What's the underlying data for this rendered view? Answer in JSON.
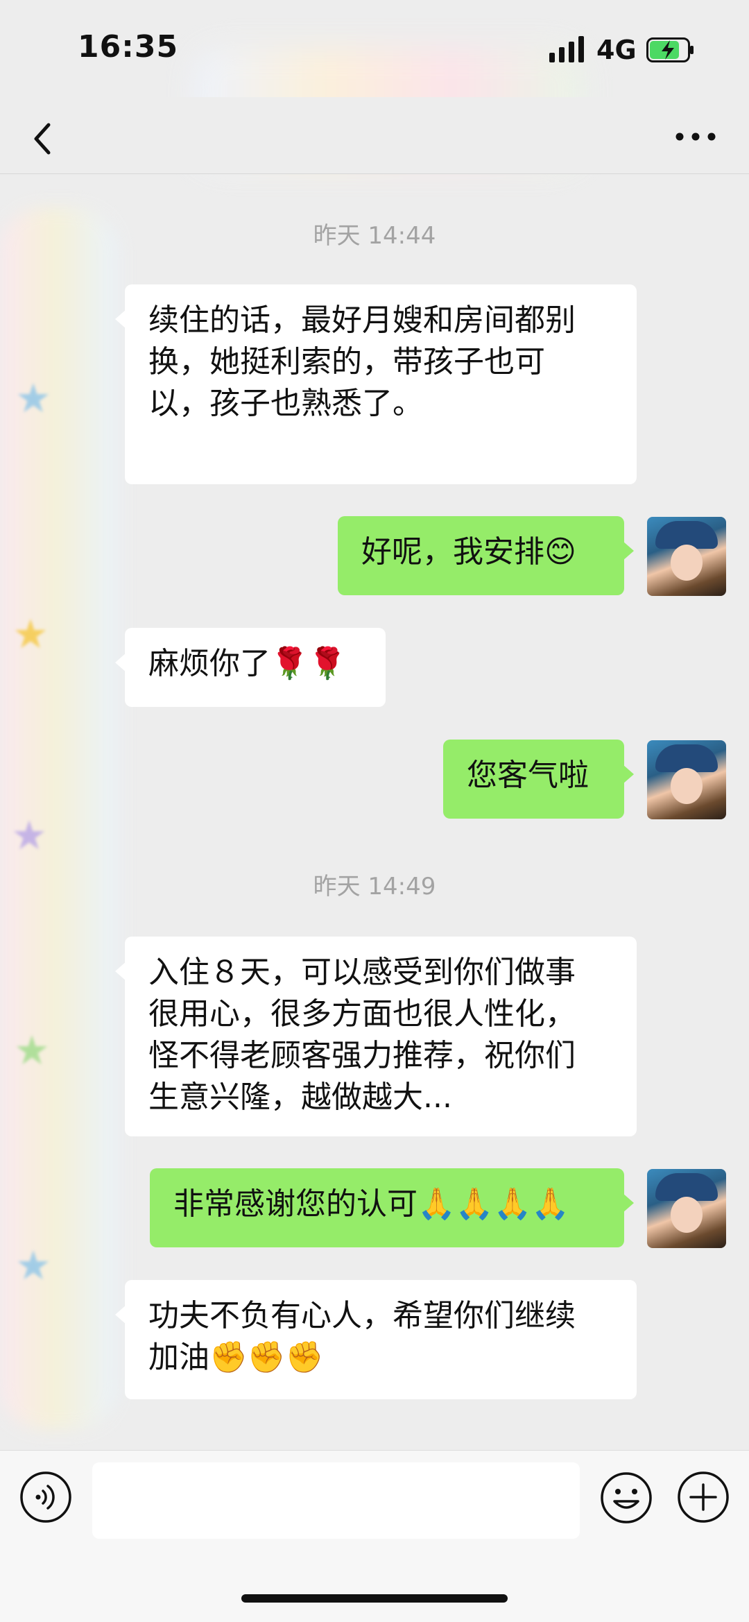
{
  "status_bar": {
    "time": "16:35",
    "network": "4G"
  },
  "messages": [
    {
      "type": "timestamp",
      "text": "昨天 14:44"
    },
    {
      "type": "in",
      "lines": [
        "续住的话，最好月嫂和房间都别",
        "换，她挺利索的，带孩子也可",
        "以，孩子也熟悉了。"
      ]
    },
    {
      "type": "out",
      "text": "好呢，我安排😊"
    },
    {
      "type": "in",
      "text": "麻烦你了🌹🌹"
    },
    {
      "type": "out",
      "text": "您客气啦"
    },
    {
      "type": "timestamp",
      "text": "昨天 14:49"
    },
    {
      "type": "in",
      "lines": [
        "入住８天，可以感受到你们做事",
        "很用心，很多方面也很人性化，",
        "怪不得老顾客强力推荐，祝你们",
        "生意兴隆，越做越大..."
      ]
    },
    {
      "type": "out",
      "text": "非常感谢您的认可🙏🙏🙏🙏"
    },
    {
      "type": "in",
      "lines": [
        "功夫不负有心人，希望你们继续",
        "加油✊✊✊"
      ]
    }
  ],
  "icons": {
    "back": "chevron-left-icon",
    "more": "ellipsis-icon",
    "voice": "voice-icon",
    "emoji": "smiley-icon",
    "add": "plus-icon"
  },
  "colors": {
    "outgoing_bubble": "#95ec69",
    "incoming_bubble": "#ffffff",
    "background": "#ededed"
  }
}
